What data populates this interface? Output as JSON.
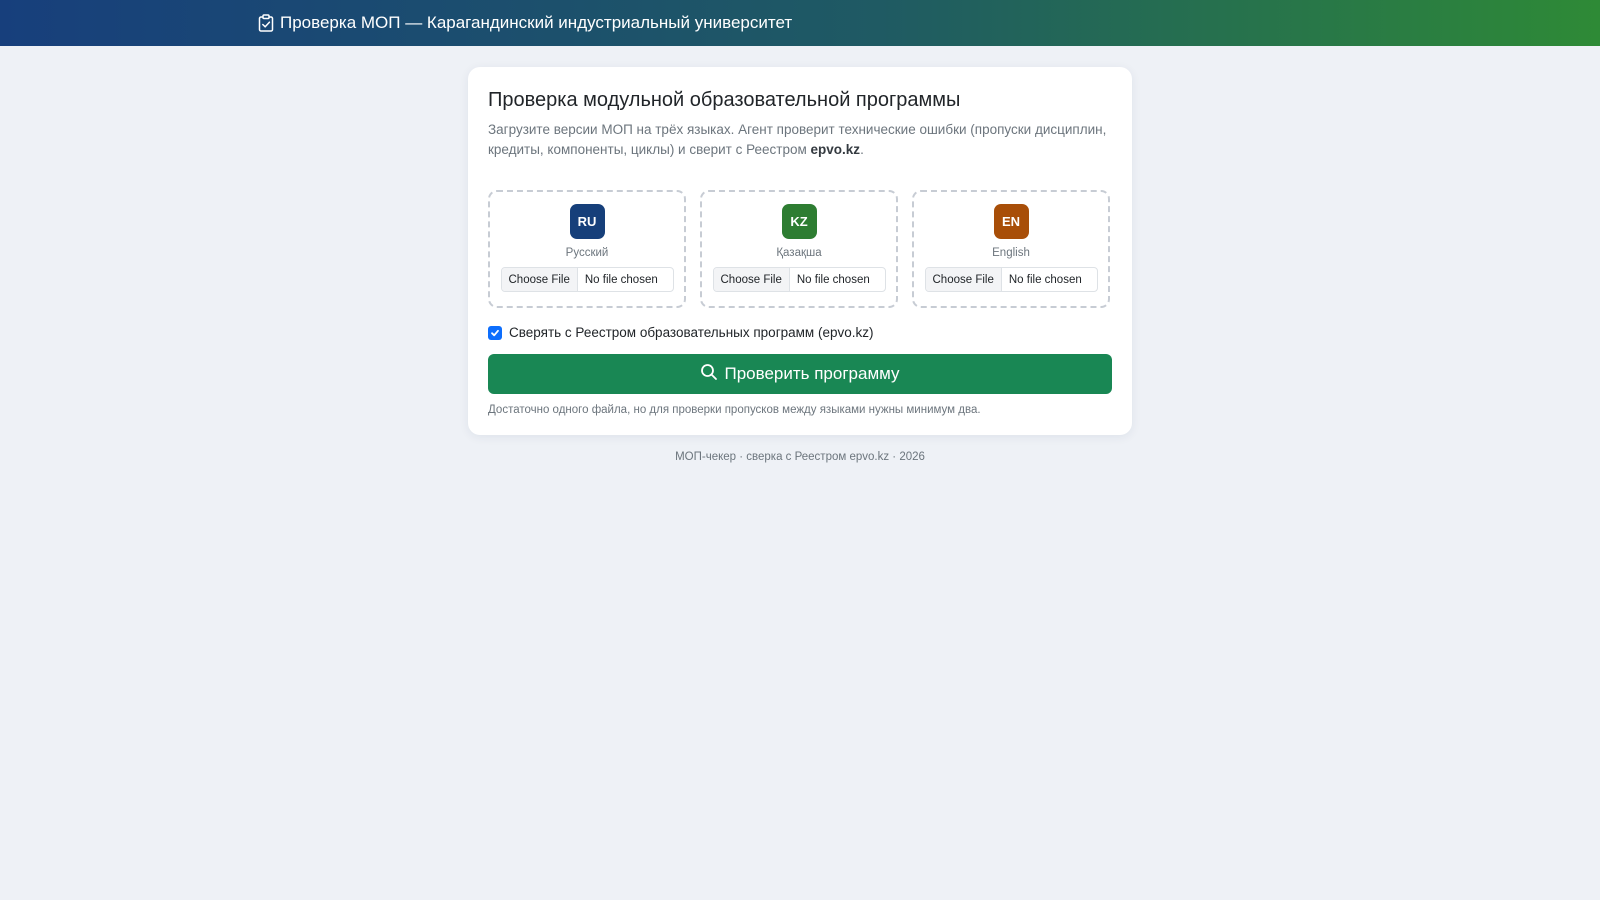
{
  "navbar": {
    "icon": "clipboard-check-icon",
    "title": "Проверка МОП — Карагандинский индустриальный университет"
  },
  "card": {
    "title": "Проверка модульной образовательной программы",
    "subtitle_text": "Загрузите версии МОП на трёх языках. Агент проверит технические ошибки (пропуски дисциплин, кредиты, компоненты, циклы) и сверит с Реестром ",
    "subtitle_bold": "epvo.kz",
    "subtitle_end": "."
  },
  "languages": [
    {
      "code": "RU",
      "name": "Русский",
      "color": "#163f7a",
      "file_button": "Choose File",
      "file_status": "No file chosen"
    },
    {
      "code": "KZ",
      "name": "Қазақша",
      "color": "#2e7d32",
      "file_button": "Choose File",
      "file_status": "No file chosen"
    },
    {
      "code": "EN",
      "name": "English",
      "color": "#a84e08",
      "file_button": "Choose File",
      "file_status": "No file chosen"
    }
  ],
  "registry_check": {
    "label": "Сверять с Реестром образовательных программ (epvo.kz)",
    "checked": true
  },
  "submit": {
    "icon": "search-icon",
    "label": "Проверить программу",
    "color": "#198754"
  },
  "hint": "Достаточно одного файла, но для проверки пропусков между языками нужны минимум два.",
  "footer": "МОП-чекер · сверка с Реестром epvo.kz · 2026"
}
